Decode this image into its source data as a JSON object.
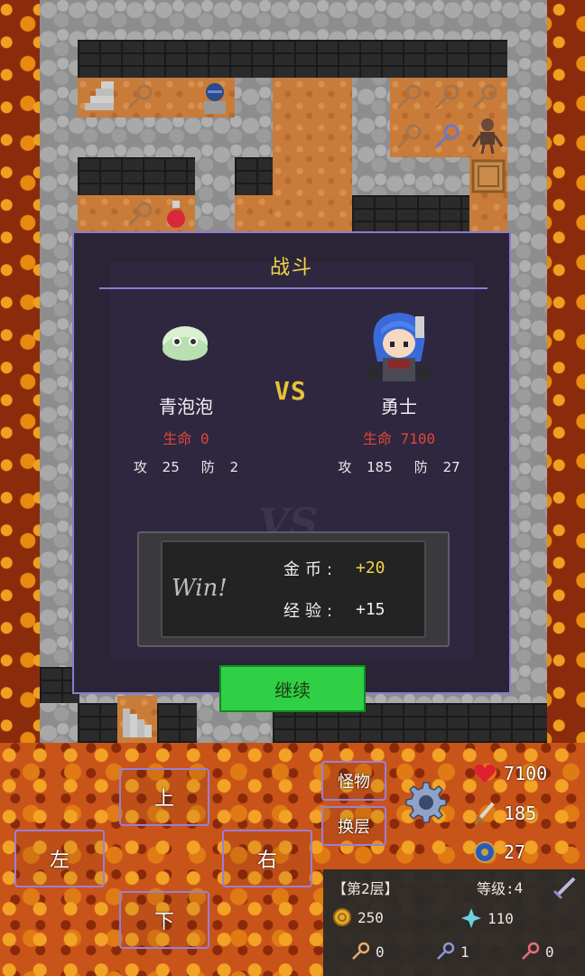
{
  "battle": {
    "title": "战斗",
    "vs_label": "VS",
    "vs_watermark": "VS",
    "monster": {
      "name": "青泡泡",
      "hp_label": "生命",
      "hp": "0",
      "atk_label": "攻",
      "atk": "25",
      "def_label": "防",
      "def": "2"
    },
    "hero": {
      "name": "勇士",
      "hp_label": "生命",
      "hp": "7100",
      "atk_label": "攻",
      "atk": "185",
      "def_label": "防",
      "def": "27"
    },
    "result": {
      "win_text": "Win!",
      "gold_label": "金币:",
      "gold_value": "+20",
      "exp_label": "经验:",
      "exp_value": "+15"
    },
    "continue_label": "继续"
  },
  "controls": {
    "up": "上",
    "down": "下",
    "left": "左",
    "right": "右",
    "monster_book": "怪物",
    "change_floor": "换层"
  },
  "hero_stats": {
    "hp": "7100",
    "atk": "185",
    "def": "27"
  },
  "status": {
    "floor": "【第2层】",
    "level_label": "等级:",
    "level": "4",
    "gold": "250",
    "exp": "110",
    "yellow_keys": "0",
    "blue_keys": "1",
    "red_keys": "0"
  },
  "colors": {
    "accent_purple": "#8a7bd0",
    "title_gold": "#f3d44a",
    "hp_red": "#e0463a",
    "gold_reward": "#f3d44a",
    "continue_green": "#2fd045"
  },
  "icons": [
    "heart-icon",
    "sword-icon",
    "shield-icon",
    "gear-icon",
    "coin-icon",
    "exp-gem-icon",
    "yellow-key-icon",
    "blue-key-icon",
    "red-key-icon",
    "sword-tool-icon"
  ]
}
